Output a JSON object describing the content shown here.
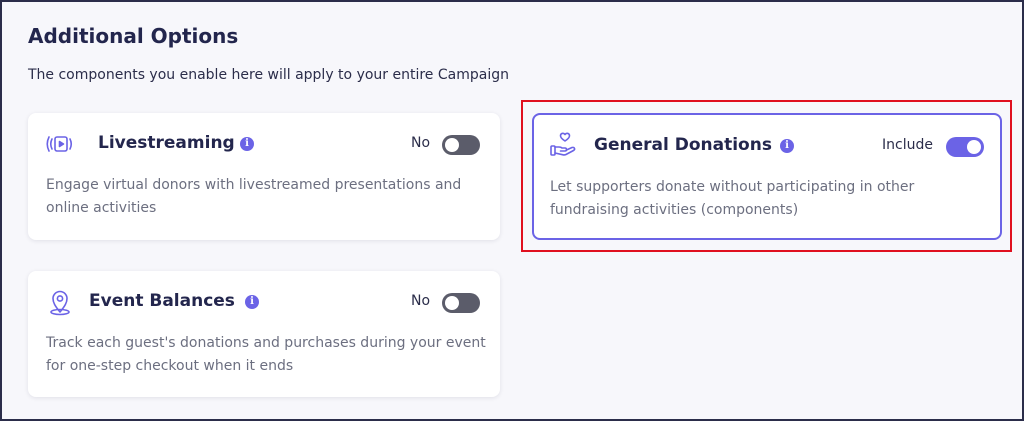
{
  "section": {
    "title": "Additional Options",
    "subtitle": "The components you enable here will apply to your entire Campaign"
  },
  "cards": {
    "livestreaming": {
      "title": "Livestreaming",
      "toggle_label": "No",
      "enabled": false,
      "icon": "video-stream-icon",
      "description": "Engage virtual donors with livestreamed presentations and online activities"
    },
    "general_donations": {
      "title": "General Donations",
      "toggle_label": "Include",
      "enabled": true,
      "icon": "heart-hand-icon",
      "description": "Let supporters donate without participating in other fundraising activities (components)"
    },
    "event_balances": {
      "title": "Event Balances",
      "toggle_label": "No",
      "enabled": false,
      "icon": "location-pin-icon",
      "description": "Track each guest's donations and purchases during your event for one-step checkout when it ends"
    }
  },
  "info_glyph": "i",
  "colors": {
    "accent": "#6b63e6",
    "title": "#23264d",
    "highlight": "#e0101f",
    "toggle_off": "#5b5c6a",
    "muted_text": "#6c6f80"
  }
}
